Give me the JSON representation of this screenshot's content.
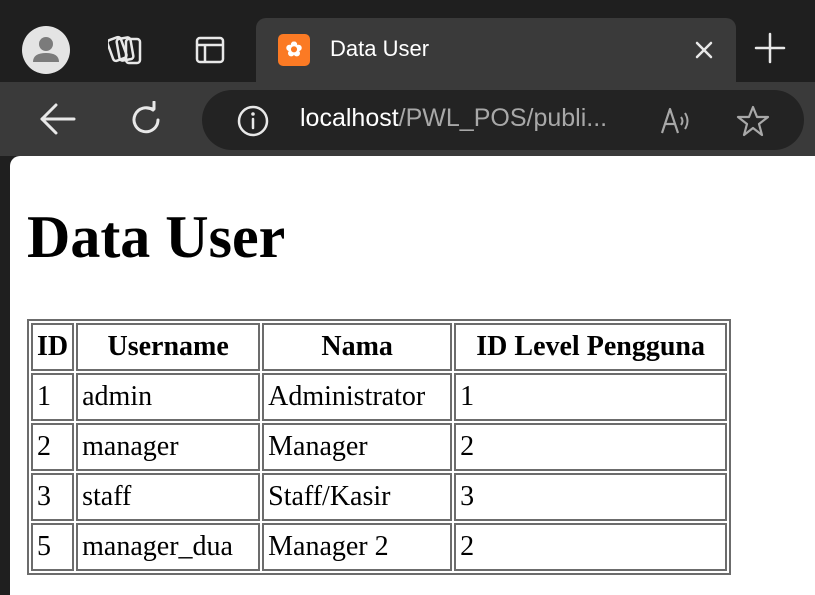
{
  "browser": {
    "tab": {
      "title": "Data User"
    },
    "address": {
      "host": "localhost",
      "path": "/PWL_POS/publi..."
    }
  },
  "page": {
    "heading": "Data User",
    "table": {
      "headers": [
        "ID",
        "Username",
        "Nama",
        "ID Level Pengguna"
      ],
      "rows": [
        [
          "1",
          "admin",
          "Administrator",
          "1"
        ],
        [
          "2",
          "manager",
          "Manager",
          "2"
        ],
        [
          "3",
          "staff",
          "Staff/Kasir",
          "3"
        ],
        [
          "5",
          "manager_dua",
          "Manager 2",
          "2"
        ]
      ]
    }
  }
}
